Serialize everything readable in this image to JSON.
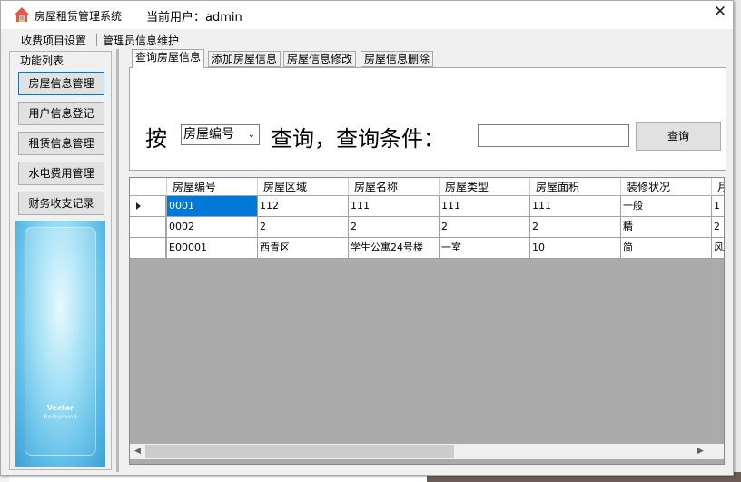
{
  "window": {
    "title": "房屋租赁管理系统",
    "current_user_label": "当前用户：admin",
    "close_symbol": "✕"
  },
  "menu": {
    "items": [
      "收费项目设置",
      "管理员信息维护"
    ]
  },
  "sidebar": {
    "legend": "功能列表",
    "buttons": [
      "房屋信息管理",
      "用户信息登记",
      "租赁信息管理",
      "水电费用管理",
      "财务收支记录"
    ],
    "promo_title": "Vector",
    "promo_sub": "Background"
  },
  "tabs": [
    "查询房屋信息",
    "添加房屋信息",
    "房屋信息修改",
    "房屋信息删除"
  ],
  "query": {
    "by_label": "按",
    "field_select": "房屋编号",
    "query_label": "查询，查询条件：",
    "input_value": "",
    "button_label": "查询"
  },
  "grid": {
    "columns": [
      "房屋编号",
      "房屋区域",
      "房屋名称",
      "房屋类型",
      "房屋面积",
      "装修状况",
      "月"
    ],
    "rows": [
      [
        "0001",
        "112",
        "111",
        "111",
        "111",
        "一般",
        "1"
      ],
      [
        "0002",
        "2",
        "2",
        "2",
        "2",
        "精",
        "2"
      ],
      [
        "E00001",
        "西青区",
        "学生公寓24号楼",
        "一室",
        "10",
        "简",
        "风"
      ]
    ],
    "selected_row": 0,
    "horizontal_scroll_fraction": 0.0
  },
  "icons": {
    "app": "house-icon",
    "row_indicator": "triangle-right-icon",
    "scroll_left": "chevron-left-icon",
    "scroll_right": "chevron-right-icon"
  },
  "colors": {
    "selection": "#0078d7",
    "window_bg": "#f0f0f0",
    "button_bg": "#e1e1e1",
    "grid_bg": "#ababab"
  }
}
